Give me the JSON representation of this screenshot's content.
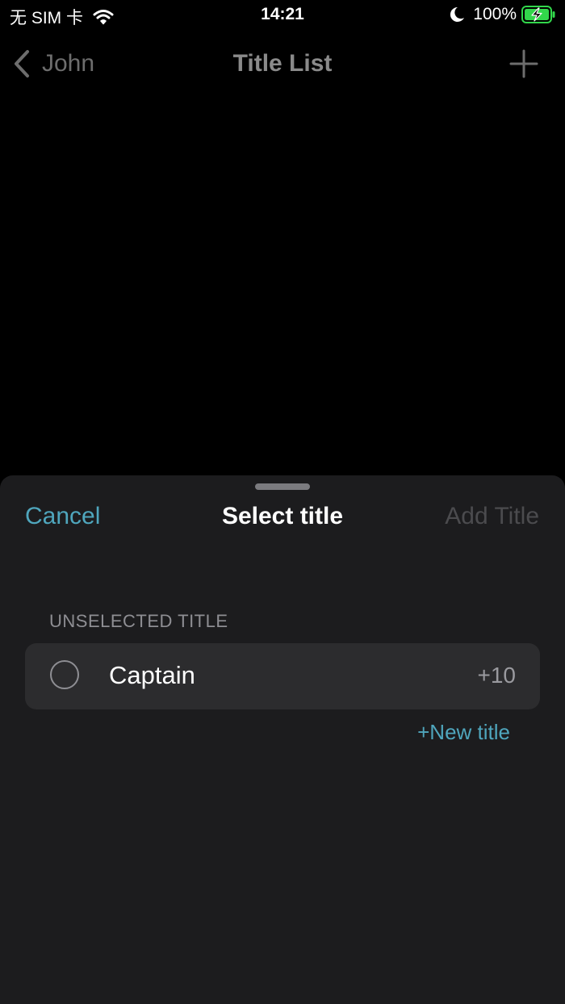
{
  "status_bar": {
    "carrier": "无 SIM 卡",
    "time": "14:21",
    "battery_percent": "100%",
    "icons": [
      "wifi-icon",
      "moon-icon",
      "battery-charging-icon"
    ]
  },
  "nav_bar": {
    "back_label": "John",
    "title": "Title List",
    "icons": [
      "chevron-left-icon",
      "plus-icon"
    ]
  },
  "sheet": {
    "cancel_label": "Cancel",
    "title": "Select title",
    "add_title_label": "Add Title",
    "section_header": "UNSELECTED TITLE",
    "titles": [
      {
        "name": "Captain",
        "points": "+10",
        "selected": false
      }
    ],
    "new_title_label": "+New title"
  },
  "colors": {
    "accent": "#4fa6bd",
    "sheet_background": "#1c1c1e",
    "row_background": "#2c2c2e",
    "battery_fill": "#32d74b",
    "disabled_text": "#4b4b4e"
  }
}
